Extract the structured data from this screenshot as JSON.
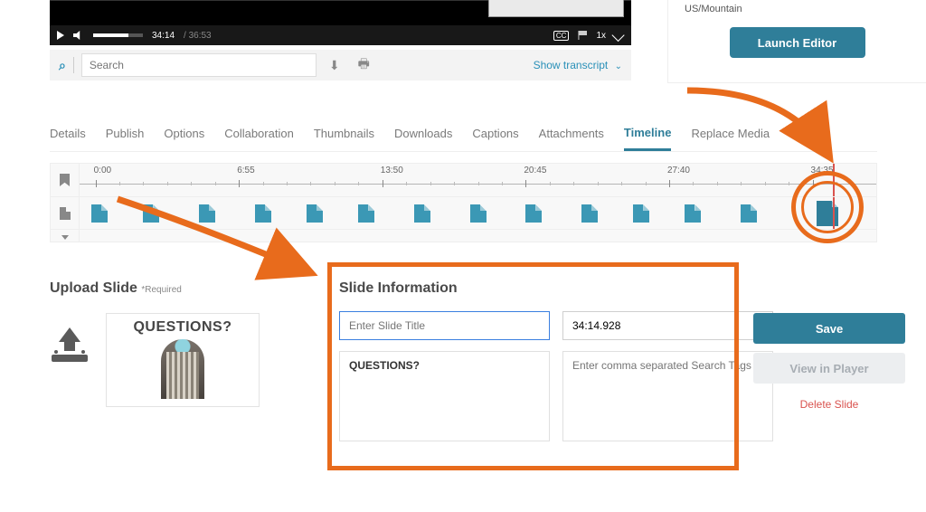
{
  "player": {
    "current_time": "34:14",
    "duration": "/ 36:53",
    "speed": "1x",
    "cc": "CC"
  },
  "search": {
    "placeholder": "Search",
    "transcript_label": "Show transcript"
  },
  "side": {
    "timezone": "US/Mountain",
    "launch_label": "Launch Editor"
  },
  "tabs": {
    "items": [
      {
        "label": "Details"
      },
      {
        "label": "Publish"
      },
      {
        "label": "Options"
      },
      {
        "label": "Collaboration"
      },
      {
        "label": "Thumbnails"
      },
      {
        "label": "Downloads"
      },
      {
        "label": "Captions"
      },
      {
        "label": "Attachments"
      },
      {
        "label": "Timeline"
      },
      {
        "label": "Replace Media"
      }
    ],
    "active_index": 8
  },
  "timeline": {
    "labels": [
      "0:00",
      "6:55",
      "13:50",
      "20:45",
      "27:40",
      "34:35"
    ],
    "label_positions_pct": [
      2,
      20,
      38,
      56,
      74,
      92
    ],
    "minor_ticks_pct": [
      5,
      8,
      11,
      14,
      17,
      23,
      26,
      29,
      32,
      35,
      41,
      44,
      47,
      50,
      53,
      59,
      62,
      65,
      68,
      71,
      77,
      80,
      83,
      86,
      89,
      95
    ],
    "playhead_pct": 94.5,
    "slide_positions_pct": [
      2.5,
      9,
      16,
      23,
      29.5,
      36,
      43,
      50,
      57,
      64,
      70.5,
      77,
      84,
      93.5
    ],
    "selected_slide_index": 13
  },
  "upload": {
    "heading": "Upload Slide",
    "required": "*Required",
    "preview_text": "QUESTIONS?"
  },
  "slide_info": {
    "heading": "Slide Information",
    "title_placeholder": "Enter Slide Title",
    "time_value": "34:14.928",
    "description_value": "QUESTIONS?",
    "tags_placeholder": "Enter comma separated Search Tags"
  },
  "actions": {
    "save": "Save",
    "view": "View in Player",
    "delete": "Delete Slide"
  }
}
